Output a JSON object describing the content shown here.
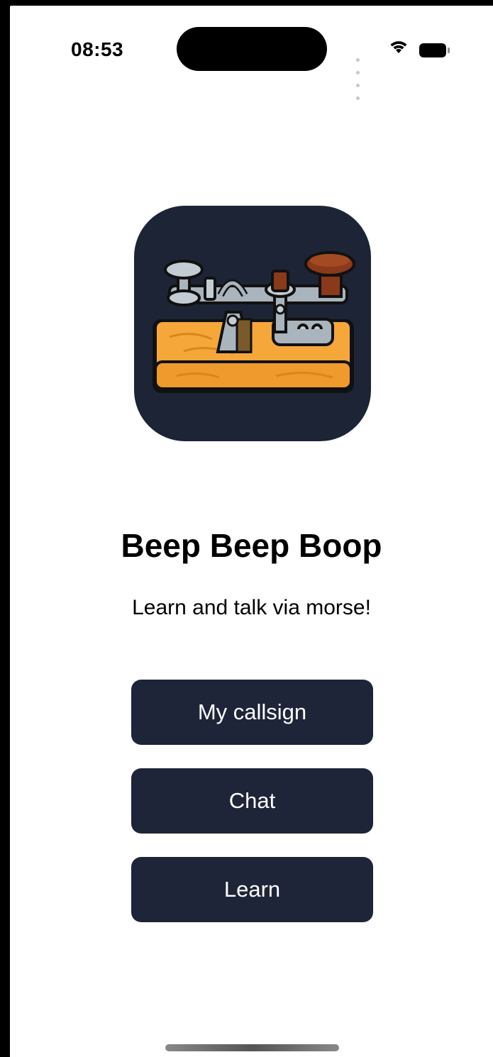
{
  "status_bar": {
    "time": "08:53",
    "icons": [
      "signal-dots-icon",
      "wifi-icon",
      "battery-icon"
    ]
  },
  "app": {
    "icon": "telegraph-key-icon",
    "title": "Beep Beep Boop",
    "subtitle": "Learn and talk via morse!"
  },
  "menu": {
    "callsign_label": "My callsign",
    "chat_label": "Chat",
    "learn_label": "Learn"
  },
  "colors": {
    "button_bg": "#1f2538",
    "icon_bg": "#1d2436",
    "wood": "#f5a73a",
    "metal": "#aab4bd",
    "knob": "#8a3a1a"
  }
}
